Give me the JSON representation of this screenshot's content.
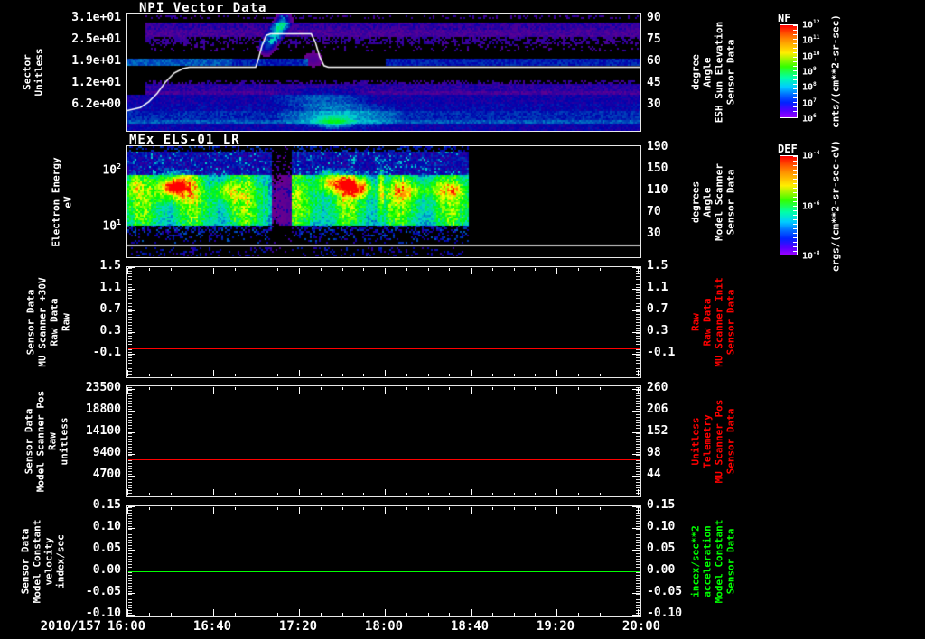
{
  "date_label": "2010/157",
  "time_axis": {
    "start": "16:00",
    "end": "20:00",
    "tick_labels": [
      "16:00",
      "16:40",
      "17:20",
      "18:00",
      "18:40",
      "19:20",
      "20:00"
    ],
    "minor_tick_minutes": 10,
    "major_tick_minutes": 40
  },
  "colors": {
    "background": "#000000",
    "axis": "#ffffff",
    "red_series": "#ff0000",
    "green_series": "#00ff00"
  },
  "panels": [
    {
      "id": "npi",
      "title": "NPI Vector Data",
      "left_label_lines": [
        "Sector",
        "Unitless"
      ],
      "left_label_color": "#ffffff",
      "left_ticks": [
        "3.1e+01",
        "2.5e+01",
        "1.9e+01",
        "1.2e+01",
        "6.2e+00"
      ],
      "right_ticks": [
        "90",
        "75",
        "60",
        "45",
        "30"
      ],
      "right_label_lines": [
        "Sensor Data",
        "ESH Sun Elevation",
        "Angle",
        "degree"
      ],
      "right_label_color": "#ffffff"
    },
    {
      "id": "els",
      "title": "MEx ELS-01 LR",
      "left_label_lines": [
        "Electron Energy",
        "eV"
      ],
      "left_label_color": "#ffffff",
      "left_ticks": [
        "10^2",
        "10^1"
      ],
      "right_ticks": [
        "190",
        "150",
        "110",
        "70",
        "30"
      ],
      "right_label_lines": [
        "Sensor Data",
        "Model Scanner",
        "Angle",
        "degrees"
      ],
      "right_label_color": "#ffffff"
    },
    {
      "id": "mu30v",
      "title": "",
      "left_label_lines": [
        "Sensor Data",
        "MU Scanner +30V",
        "Raw Data",
        "Raw"
      ],
      "left_label_color": "#ffffff",
      "left_ticks": [
        "1.5",
        "1.1",
        "0.7",
        "0.3",
        "-0.1"
      ],
      "right_ticks": [
        "1.5",
        "1.1",
        "0.7",
        "0.3",
        "-0.1"
      ],
      "right_label_lines": [
        "Sensor Data",
        "MU Scanner Init",
        "Raw Data",
        "Raw"
      ],
      "right_label_color": "#ff0000",
      "line_color": "#ff0000"
    },
    {
      "id": "scanpos",
      "title": "",
      "left_label_lines": [
        "Sensor Data",
        "Model Scanner Pos",
        "Raw",
        "unitless"
      ],
      "left_label_color": "#ffffff",
      "left_ticks": [
        "23500",
        "18800",
        "14100",
        "9400",
        "4700"
      ],
      "right_ticks": [
        "260",
        "206",
        "152",
        "98",
        "44"
      ],
      "right_label_lines": [
        "Sensor Data",
        "MU Scanner Pos",
        "Telemetry",
        "Unitless"
      ],
      "right_label_color": "#ff0000",
      "line_color": "#ff0000"
    },
    {
      "id": "velocity",
      "title": "",
      "left_label_lines": [
        "Sensor Data",
        "Model Constant",
        "velocity",
        "index/sec"
      ],
      "left_label_color": "#ffffff",
      "left_ticks": [
        "0.15",
        "0.10",
        "0.05",
        "0.00",
        "-0.05",
        "-0.10"
      ],
      "right_ticks": [
        "0.15",
        "0.10",
        "0.05",
        "0.00",
        "-0.05",
        "-0.10"
      ],
      "right_label_lines": [
        "Sensor Data",
        "Model Constant",
        "acceleration",
        "incex/sec**2"
      ],
      "right_label_color": "#00ff00",
      "line_color": "#00ff00"
    }
  ],
  "colorbars": [
    {
      "title": "NF",
      "tick_labels": [
        "10^12",
        "10^11",
        "10^10",
        "10^9",
        "10^8",
        "10^7",
        "10^6"
      ],
      "unit": "cnts/(cm**2-sr-sec)"
    },
    {
      "title": "DEF",
      "tick_labels": [
        "10^-4",
        "10^-6",
        "10^-8"
      ],
      "unit": "ergs/(cm**2-sr-sec-eV)"
    }
  ],
  "chart_data": [
    {
      "type": "heatmap",
      "title": "NPI Vector Data",
      "ylabel": "Sector Unitless",
      "y_ticks": [
        "3.1e+01",
        "2.5e+01",
        "1.9e+01",
        "1.2e+01",
        "6.2e+00"
      ],
      "x_range": [
        "16:00",
        "20:00"
      ],
      "right_axis": {
        "label": "Sensor Data ESH Sun Elevation Angle degree",
        "ticks": [
          90,
          75,
          60,
          45,
          30
        ]
      },
      "colorbar": {
        "title": "NF",
        "unit": "cnts/(cm**2-sr-sec)",
        "scale": "log",
        "tick_exponents": [
          12,
          11,
          10,
          9,
          8,
          7,
          6
        ]
      },
      "description": "Sector-vs-time count spectrogram; violet/blue horizontal bands with black gaps, brighter blue row near sector 19, cyan enhancements ~17:00-18:00 in lower sectors, diagonal cyan streak ~17:05 in upper sectors",
      "overlay_line": {
        "name": "ESH Sun Elevation Angle (deg)",
        "points_time_deg": [
          [
            "16:00",
            26
          ],
          [
            "16:06",
            28
          ],
          [
            "16:10",
            32
          ],
          [
            "16:14",
            38
          ],
          [
            "16:18",
            46
          ],
          [
            "16:22",
            52
          ],
          [
            "16:26",
            55
          ],
          [
            "16:29",
            56
          ],
          [
            "17:00",
            56
          ],
          [
            "17:01",
            60
          ],
          [
            "17:03",
            71
          ],
          [
            "17:05",
            78
          ],
          [
            "17:07",
            79
          ],
          [
            "17:26",
            79
          ],
          [
            "17:28",
            73
          ],
          [
            "17:30",
            63
          ],
          [
            "17:32",
            57
          ],
          [
            "17:34",
            56
          ],
          [
            "20:00",
            56
          ]
        ]
      }
    },
    {
      "type": "heatmap",
      "title": "MEx ELS-01 LR",
      "ylabel": "Electron Energy eV",
      "yscale": "log",
      "y_ticks": [
        "10^2",
        "10^1"
      ],
      "right_axis": {
        "label": "Sensor Data Model Scanner Angle degrees",
        "ticks": [
          190,
          150,
          110,
          70,
          30
        ]
      },
      "colorbar": {
        "title": "DEF",
        "unit": "ergs/(cm**2-sr-sec-eV)",
        "scale": "log",
        "tick_exponents": [
          -4,
          -6,
          -8
        ]
      },
      "data_interval": [
        "16:00",
        "18:40"
      ],
      "overlay_line_eV": 5,
      "description": "Electron energy-time spectrogram: broad green band 10-60 eV from 16:00 to 18:40; intense red/yellow flux 30-100 eV near 16:05-16:30 and 17:20-18:00; dark vertical gap ~17:05-17:15; black (no data) after 18:40; white horizontal marker line near 5 eV"
    },
    {
      "type": "line",
      "series": [
        {
          "name": "Sensor Data MU Scanner +30V Raw Data Raw",
          "color": "#ff0000",
          "constant_value": 0.0
        }
      ],
      "y_ticks": [
        1.5,
        1.1,
        0.7,
        0.3,
        -0.1
      ],
      "right_axis": {
        "label": "Sensor Data MU Scanner Init Raw Data Raw",
        "ticks": [
          1.5,
          1.1,
          0.7,
          0.3,
          -0.1
        ]
      },
      "x_range": [
        "16:00",
        "20:00"
      ]
    },
    {
      "type": "line",
      "series": [
        {
          "name": "Sensor Data Model Scanner Pos Raw unitless",
          "color": "#ff0000",
          "constant_value": 8200
        }
      ],
      "y_ticks": [
        23500,
        18800,
        14100,
        9400,
        4700
      ],
      "right_axis": {
        "label": "Sensor Data MU Scanner Pos Telemetry Unitless",
        "ticks": [
          260,
          206,
          152,
          98,
          44
        ]
      },
      "x_range": [
        "16:00",
        "20:00"
      ]
    },
    {
      "type": "line",
      "series": [
        {
          "name": "Sensor Data Model Constant velocity index/sec",
          "color": "#00ff00",
          "constant_value": 0.0
        }
      ],
      "y_ticks": [
        0.15,
        0.1,
        0.05,
        0.0,
        -0.05,
        -0.1
      ],
      "right_axis": {
        "label": "Sensor Data Model Constant acceleration incex/sec**2",
        "ticks": [
          0.15,
          0.1,
          0.05,
          0.0,
          -0.05,
          -0.1
        ]
      },
      "x_range": [
        "16:00",
        "20:00"
      ]
    }
  ]
}
